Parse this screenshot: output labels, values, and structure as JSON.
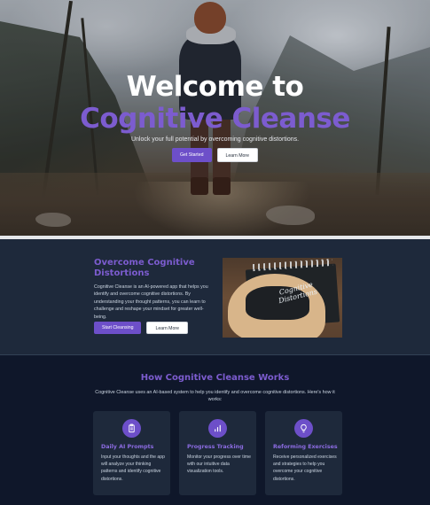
{
  "hero": {
    "title_line1": "Welcome to",
    "title_line2": "Cognitive Cleanse",
    "subtitle": "Unlock your full potential by overcoming cognitive distortions.",
    "primary_button": "Get Started",
    "secondary_button": "Learn More"
  },
  "overcome": {
    "title": "Overcome Cognitive Distortions",
    "text": "Cognitive Cleanse is an AI-powered app that helps you identify and overcome cognitive distortions. By understanding your thought patterns, you can learn to challenge and reshape your mindset for greater well-being.",
    "primary_button": "Start Cleansing",
    "secondary_button": "Learn More",
    "image_text": "Cognitive Distortions"
  },
  "how": {
    "title": "How Cognitive Cleanse Works",
    "subtitle": "Cognitive Cleanse uses an AI-based system to help you identify and overcome cognitive distortions. Here's how it works:",
    "cards": [
      {
        "icon": "clipboard-icon",
        "title": "Daily AI Prompts",
        "text": "Input your thoughts and the app will analyze your thinking patterns and identify cognitive distortions."
      },
      {
        "icon": "bar-chart-icon",
        "title": "Progress Tracking",
        "text": "Monitor your progress over time with our intuitive data visualization tools."
      },
      {
        "icon": "lightbulb-icon",
        "title": "Reforming Exercises",
        "text": "Receive personalized exercises and strategies to help you overcome your cognitive distortions."
      }
    ]
  },
  "colors": {
    "accent": "#7c5ccf",
    "button": "#6d4fc9",
    "section_bg": "#1e293b",
    "page_bg": "#0f172a"
  }
}
